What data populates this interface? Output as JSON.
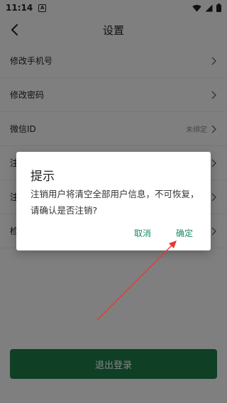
{
  "status_bar": {
    "time": "11:14",
    "notification_glyph": "A"
  },
  "app_bar": {
    "title": "设置"
  },
  "settings": [
    {
      "label": "修改手机号",
      "value": ""
    },
    {
      "label": "修改密码",
      "value": ""
    },
    {
      "label": "微信ID",
      "value": "未绑定"
    },
    {
      "label": "注",
      "value": ""
    },
    {
      "label": "注",
      "value": ""
    },
    {
      "label": "检",
      "value": ""
    }
  ],
  "logout_label": "退出登录",
  "dialog": {
    "title": "提示",
    "message": "注销用户将清空全部用户信息，不可恢复，请确认是否注销?",
    "cancel_label": "取消",
    "confirm_label": "确定"
  },
  "colors": {
    "primary_green": "#1d7a45",
    "dialog_button_teal": "#1c8a6a",
    "annotation_arrow": "#e53935",
    "overlay": "rgba(0,0,0,0.48)"
  },
  "icons": [
    "back-icon",
    "chevron-right-icon",
    "wifi-icon",
    "signal-icon",
    "battery-icon"
  ]
}
